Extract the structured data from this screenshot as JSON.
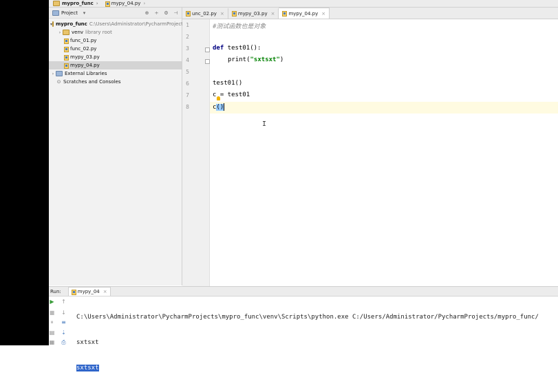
{
  "breadcrumb": {
    "project": "mypro_func",
    "file": "mypy_04.py"
  },
  "project_panel": {
    "title": "Project",
    "tree": [
      {
        "label": "mypro_func",
        "hint": "C:\\Users\\Administrator\\PycharmProject"
      },
      {
        "label": "venv",
        "hint": "library root"
      },
      {
        "label": "func_01.py"
      },
      {
        "label": "func_02.py"
      },
      {
        "label": "mypy_03.py"
      },
      {
        "label": "mypy_04.py"
      },
      {
        "label": "External Libraries"
      },
      {
        "label": "Scratches and Consoles"
      }
    ]
  },
  "tabs": [
    {
      "label": "unc_02.py"
    },
    {
      "label": "mypy_03.py"
    },
    {
      "label": "mypy_04.py"
    }
  ],
  "editor": {
    "line_numbers": [
      "1",
      "2",
      "3",
      "4",
      "5",
      "6",
      "7",
      "8"
    ],
    "comment": "#测试函数也是对象",
    "def_kw": "def",
    "def_rest": " test01():",
    "print_fn": "print(",
    "print_str": "\"sxtsxt\"",
    "print_close": ")",
    "line6": "test01()",
    "line7": "c = test01",
    "line8_name": "c",
    "line8_paren": "()"
  },
  "run": {
    "label": "Run:",
    "tab": "mypy_04",
    "command": "C:\\Users\\Administrator\\PycharmProjects\\mypro_func\\venv\\Scripts\\python.exe C:/Users/Administrator/PycharmProjects/mypro_func/",
    "output1": "sxtsxt",
    "output2": "sxtsxt"
  }
}
